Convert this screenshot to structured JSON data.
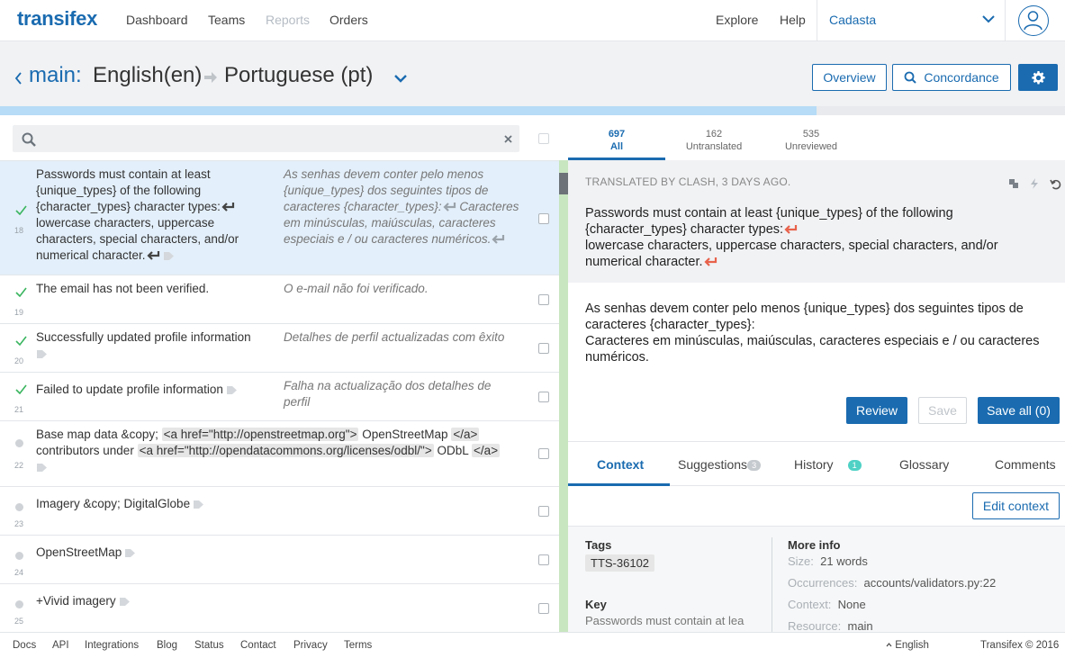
{
  "app": {
    "logo": "transifex",
    "brand_color": "#1a6bb0"
  },
  "topnav": {
    "items": [
      {
        "label": "Dashboard",
        "enabled": true
      },
      {
        "label": "Teams",
        "enabled": true
      },
      {
        "label": "Reports",
        "enabled": false
      },
      {
        "label": "Orders",
        "enabled": true
      }
    ],
    "explore": "Explore",
    "help": "Help",
    "project": "Cadasta"
  },
  "header": {
    "resource": "main:",
    "source_lang": "English(en)",
    "target_lang": "Portuguese (pt)",
    "overview_label": "Overview",
    "concordance_label": "Concordance"
  },
  "progress": {
    "translated_fraction": 0.767
  },
  "search": {
    "placeholder": "",
    "value": ""
  },
  "stats_tabs": [
    {
      "count": "697",
      "label": "All"
    },
    {
      "count": "162",
      "label": "Untranslated"
    },
    {
      "count": "535",
      "label": "Unreviewed"
    }
  ],
  "strings": [
    {
      "num": "18",
      "status": "translated",
      "src_parts": [
        "Passwords must contain at least {unique_types} of the following {character_types} character types:",
        "lowercase characters, uppercase characters, special characters, and/or numerical character."
      ],
      "tgt_parts": [
        "As senhas devem conter pelo menos {unique_types} dos seguintes tipos de caracteres {character_types}:",
        "Caracteres em minúsculas, maiúsculas, caracteres especiais e / ou caracteres numéricos."
      ]
    },
    {
      "num": "19",
      "status": "translated",
      "src": "The email has not been verified.",
      "tgt": "O e-mail não foi verificado."
    },
    {
      "num": "20",
      "status": "translated",
      "src": "Successfully updated profile information",
      "tgt": "Detalhes de perfil actualizadas com êxito"
    },
    {
      "num": "21",
      "status": "translated",
      "src": "Failed to update profile information",
      "tgt": "Falha na actualização dos detalhes de perfil"
    },
    {
      "num": "22",
      "status": "untranslated",
      "src_parts": [
        "Base map data &copy;",
        "<a href=\"http://openstreetmap.org\">",
        "OpenStreetMap",
        "</a>",
        "contributors under",
        "<a href=\"http://opendatacommons.org/licenses/odbl/\">",
        "ODbL",
        "</a>"
      ]
    },
    {
      "num": "23",
      "status": "untranslated",
      "src": "Imagery &copy; DigitalGlobe"
    },
    {
      "num": "24",
      "status": "untranslated",
      "src": "OpenStreetMap"
    },
    {
      "num": "25",
      "status": "untranslated",
      "src": "+Vivid imagery"
    }
  ],
  "editor": {
    "meta": "TRANSLATED BY CLASH, 3 DAYS AGO.",
    "source_lines": [
      "Passwords must contain at least {unique_types} of the following {character_types} character types:",
      "lowercase characters, uppercase characters, special characters, and/or numerical character."
    ],
    "translation_lines": [
      "As senhas devem conter pelo menos {unique_types} dos seguintes tipos de caracteres {character_types}:",
      "Caracteres em minúsculas, maiúsculas, caracteres especiais e / ou caracteres numéricos."
    ],
    "review_label": "Review",
    "save_label": "Save",
    "save_all_label": "Save all (0)"
  },
  "context_tabs": {
    "context": "Context",
    "suggestions": "Suggestions",
    "suggestions_count": "3",
    "history": "History",
    "history_count": "1",
    "glossary": "Glossary",
    "comments": "Comments"
  },
  "context": {
    "edit_label": "Edit context",
    "tags_label": "Tags",
    "tag": "TTS-36102",
    "key_label": "Key",
    "key_value": "Passwords must contain at lea",
    "more_info_label": "More info",
    "size_label": "Size:",
    "size_value": "21 words",
    "occurrences_label": "Occurrences:",
    "occurrences_value": "accounts/validators.py:22",
    "context_label": "Context:",
    "context_value": "None",
    "resource_label": "Resource:",
    "resource_value": "main"
  },
  "footer": {
    "links": [
      "Docs",
      "API",
      "Integrations",
      "Blog",
      "Status",
      "Contact",
      "Privacy",
      "Terms"
    ],
    "language": "English",
    "copyright": "Transifex © 2016"
  },
  "colors": {
    "status_green": "#3ab55f",
    "newline_red": "#e8624b",
    "teal_badge": "#4fd1c5"
  }
}
